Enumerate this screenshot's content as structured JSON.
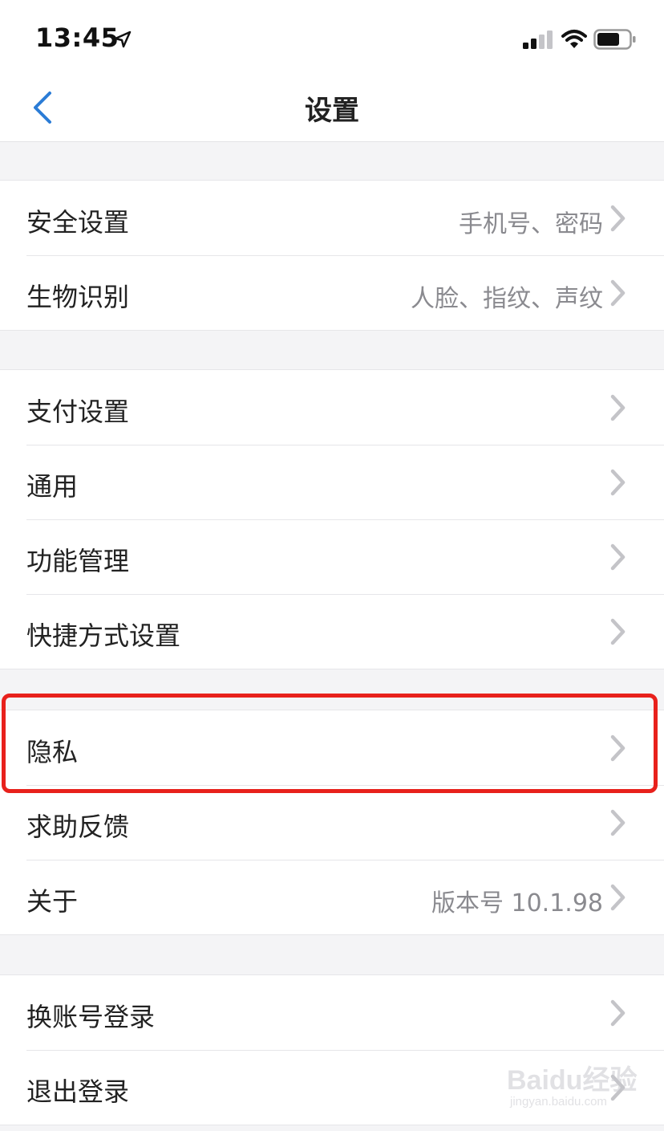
{
  "status_bar": {
    "time": "13:45"
  },
  "nav": {
    "title": "设置"
  },
  "sections": [
    {
      "rows": [
        {
          "label": "安全设置",
          "value": "手机号、密码"
        },
        {
          "label": "生物识别",
          "value": "人脸、指纹、声纹"
        }
      ]
    },
    {
      "rows": [
        {
          "label": "支付设置",
          "value": ""
        },
        {
          "label": "通用",
          "value": ""
        },
        {
          "label": "功能管理",
          "value": ""
        },
        {
          "label": "快捷方式设置",
          "value": ""
        }
      ]
    },
    {
      "rows": [
        {
          "label": "隐私",
          "value": ""
        },
        {
          "label": "求助反馈",
          "value": ""
        },
        {
          "label": "关于",
          "value": "版本号 10.1.98"
        }
      ]
    },
    {
      "rows": [
        {
          "label": "换账号登录",
          "value": ""
        },
        {
          "label": "退出登录",
          "value": ""
        }
      ]
    }
  ],
  "watermark": {
    "brand": "Baidu经验",
    "url": "jingyan.baidu.com"
  },
  "colors": {
    "accent": "#2b7cd6",
    "highlight": "#e8211c",
    "chevron": "#c4c4c8"
  }
}
